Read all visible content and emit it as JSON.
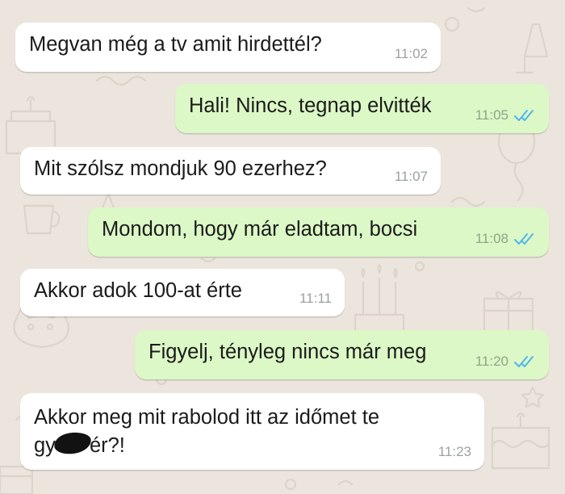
{
  "conversation": {
    "messages": [
      {
        "direction": "incoming",
        "text": "Megvan még a tv amit hirdettél?",
        "time": "11:02"
      },
      {
        "direction": "outgoing",
        "text": "Hali! Nincs, tegnap elvitték",
        "time": "11:05",
        "status": "read"
      },
      {
        "direction": "incoming",
        "text": "Mit szólsz mondjuk 90 ezerhez?",
        "time": "11:07"
      },
      {
        "direction": "outgoing",
        "text": "Mondom, hogy már eladtam, bocsi",
        "time": "11:08",
        "status": "read"
      },
      {
        "direction": "incoming",
        "text": "Akkor adok 100-at érte",
        "time": "11:11"
      },
      {
        "direction": "outgoing",
        "text": "Figyelj, tényleg nincs már meg",
        "time": "11:20",
        "status": "read"
      },
      {
        "direction": "incoming",
        "line1": "Akkor meg mit rabolod itt az időmet te",
        "line2_start": "gy",
        "line2_end": "ér?!",
        "time": "11:23",
        "redacted": true
      }
    ]
  },
  "colors": {
    "wallpaper": "#ece5dd",
    "incoming_bubble": "#ffffff",
    "outgoing_bubble": "#dcf8c6",
    "read_ticks": "#4fb6ec",
    "timestamp": "#9aa39a"
  },
  "icons": {
    "read_receipt": "double-check-icon",
    "wallpaper": "doodle-pattern-icon"
  }
}
